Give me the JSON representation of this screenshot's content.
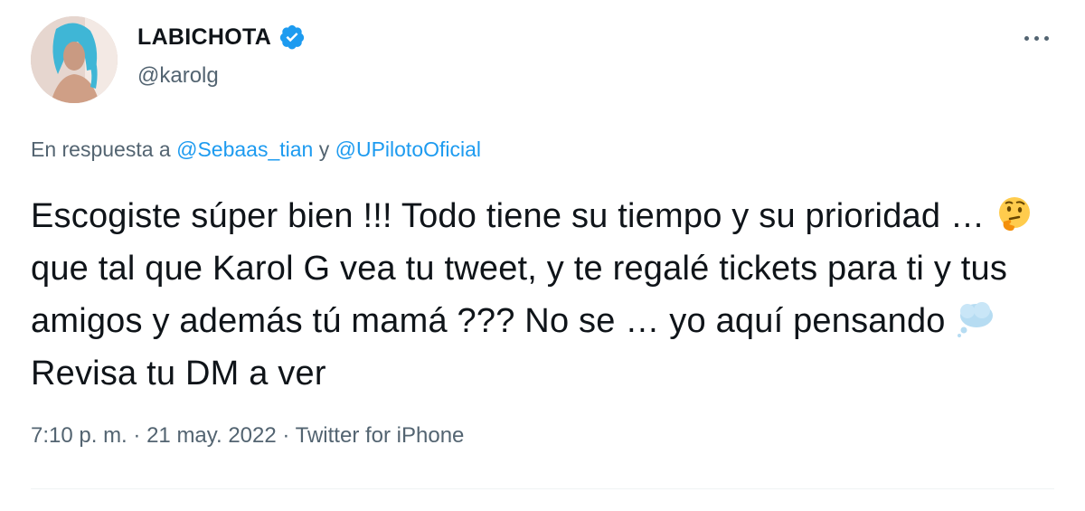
{
  "user": {
    "display_name": "LABICHOTA",
    "handle": "@karolg",
    "verified": true,
    "verified_color": "#1d9bf0"
  },
  "reply": {
    "prefix": "En respuesta a",
    "mentions": [
      "@Sebaas_tian",
      "@UPilotoOficial"
    ],
    "joiner": "y"
  },
  "tweet": {
    "part1": "Escogiste súper bien !!! Todo tiene su tiempo y su prioridad … ",
    "emoji1": "thinking-face",
    "part2": " que tal que Karol G vea tu tweet, y te regalé tickets para ti y tus amigos y además tú mamá ??? No se … yo aquí pensando ",
    "emoji2": "thought-balloon",
    "part3": " Revisa tu DM a ver"
  },
  "meta": {
    "time": "7:10 p. m.",
    "sep": "·",
    "date": "21 may. 2022",
    "source": "Twitter for iPhone"
  },
  "colors": {
    "text": "#0f1419",
    "secondary": "#536471",
    "link": "#1d9bf0"
  }
}
